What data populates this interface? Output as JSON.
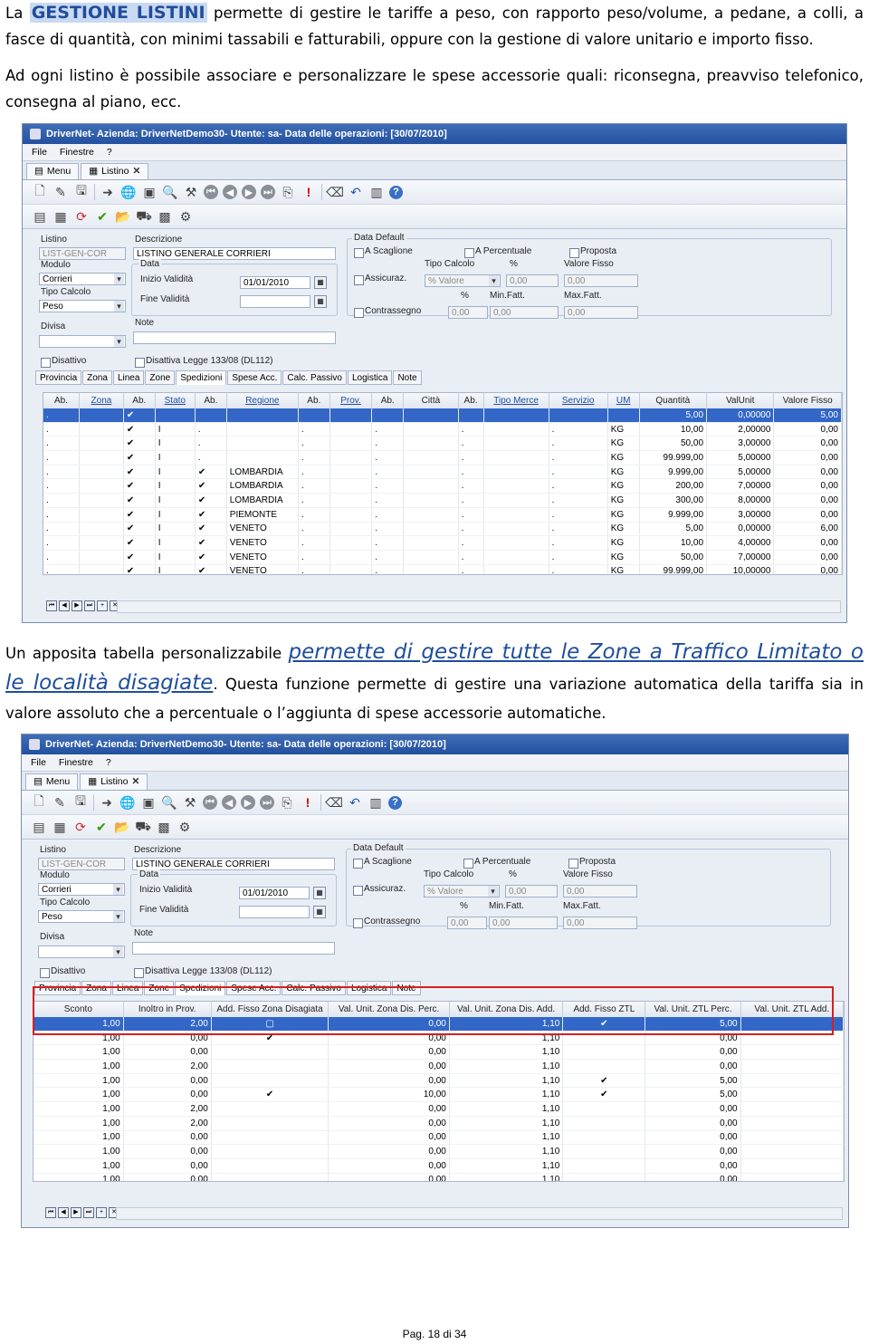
{
  "intro": {
    "la": "La",
    "highlight": "GESTIONE LISTINI",
    "rest": "permette di gestire le tariffe a peso, con rapporto peso/volume, a pedane, a colli, a fasce di quantità, con minimi tassabili e fatturabili, oppure con la gestione di valore unitario e importo fisso.",
    "line2": "Ad ogni listino è possibile associare e personalizzare le spese accessorie quali: riconsegna, preavviso telefonico, consegna al piano, ecc."
  },
  "para2": {
    "before": "Un apposita tabella personalizzabile",
    "link": "permette di gestire tutte le Zone a Traffico Limitato o le località disagiate",
    "after": ". Questa funzione permette di gestire una variazione automatica della tariffa sia in valore assoluto che a percentuale o l’aggiunta di spese accessorie automatiche."
  },
  "footer": "Pag. 18 di 34",
  "window": {
    "title1": "DriverNet- Azienda: DriverNetDemo30- Utente: sa- Data delle operazioni: [30/07/2010]",
    "title2": "DriverNet- Azienda: DriverNetDemo30- Utente: sa- Data delle operazioni: [30/07/2010]",
    "menu": [
      "File",
      "Finestre",
      "?"
    ],
    "tabs": [
      "Menu",
      "Listino"
    ]
  },
  "form": {
    "listino_label": "Listino",
    "listino_value": "LIST-GEN-COR",
    "descr_label": "Descrizione",
    "descr_value": "LISTINO GENERALE CORRIERI",
    "modulo_label": "Modulo",
    "modulo_value": "Corrieri",
    "tipo_label": "Tipo Calcolo",
    "tipo_value": "Peso",
    "divisa_label": "Divisa",
    "note_label": "Note",
    "data_label": "Data",
    "inizio_label": "Inizio Validità",
    "inizio_value": "01/01/2010",
    "fine_label": "Fine Validità",
    "datadef_label": "Data Default",
    "scaglione": "A Scaglione",
    "percentuale": "A Percentuale",
    "proposta": "Proposta",
    "assicuraz": "Assicuraz.",
    "tipocalc2": "Tipo Calcolo",
    "perc": "%",
    "valorefisso": "Valore Fisso",
    "percvalore": "% Valore",
    "zero": "0,00",
    "perc2": "%",
    "minfatt": "Min.Fatt.",
    "maxfatt": "Max.Fatt.",
    "contrassegno": "Contrassegno",
    "disattivo": "Disattivo",
    "legge": "Disattiva Legge 133/08 (DL112)"
  },
  "subtabs": [
    "Provincia",
    "Zona",
    "Linea",
    "Zone",
    "Spedizioni",
    "Spese Acc.",
    "Calc. Passivo",
    "Logistica",
    "Note"
  ],
  "grid1": {
    "headers": [
      "Ab.",
      "Zona",
      "Ab.",
      "Stato",
      "Ab.",
      "Regione",
      "Ab.",
      "Prov.",
      "Ab.",
      "Città",
      "Ab.",
      "Tipo Merce",
      "Servizio",
      "UM",
      "Quantità",
      "ValUnit",
      "Valore Fisso"
    ],
    "rows": [
      [
        ".",
        "",
        "✔",
        "",
        "",
        "",
        "",
        "",
        "",
        "",
        "",
        "",
        "",
        "",
        "5,00",
        "0,00000",
        "5,00"
      ],
      [
        ".",
        "",
        "✔",
        "I",
        ".",
        "",
        ".",
        "",
        ".",
        "",
        ".",
        "",
        ".",
        "KG",
        "10,00",
        "2,00000",
        "0,00"
      ],
      [
        ".",
        "",
        "✔",
        "I",
        ".",
        "",
        ".",
        "",
        ".",
        "",
        ".",
        "",
        ".",
        "KG",
        "50,00",
        "3,00000",
        "0,00"
      ],
      [
        ".",
        "",
        "✔",
        "I",
        ".",
        "",
        ".",
        "",
        ".",
        "",
        ".",
        "",
        ".",
        "KG",
        "99.999,00",
        "5,00000",
        "0,00"
      ],
      [
        ".",
        "",
        "✔",
        "I",
        "✔",
        "LOMBARDIA",
        ".",
        "",
        ".",
        "",
        ".",
        "",
        ".",
        "KG",
        "9.999,00",
        "5,00000",
        "0,00"
      ],
      [
        ".",
        "",
        "✔",
        "I",
        "✔",
        "LOMBARDIA",
        ".",
        "",
        ".",
        "",
        ".",
        "",
        ".",
        "KG",
        "200,00",
        "7,00000",
        "0,00"
      ],
      [
        ".",
        "",
        "✔",
        "I",
        "✔",
        "LOMBARDIA",
        ".",
        "",
        ".",
        "",
        ".",
        "",
        ".",
        "KG",
        "300,00",
        "8,00000",
        "0,00"
      ],
      [
        ".",
        "",
        "✔",
        "I",
        "✔",
        "PIEMONTE",
        ".",
        "",
        ".",
        "",
        ".",
        "",
        ".",
        "KG",
        "9.999,00",
        "3,00000",
        "0,00"
      ],
      [
        ".",
        "",
        "✔",
        "I",
        "✔",
        "VENETO",
        ".",
        "",
        ".",
        "",
        ".",
        "",
        ".",
        "KG",
        "5,00",
        "0,00000",
        "6,00"
      ],
      [
        ".",
        "",
        "✔",
        "I",
        "✔",
        "VENETO",
        ".",
        "",
        ".",
        "",
        ".",
        "",
        ".",
        "KG",
        "10,00",
        "4,00000",
        "0,00"
      ],
      [
        ".",
        "",
        "✔",
        "I",
        "✔",
        "VENETO",
        ".",
        "",
        ".",
        "",
        ".",
        "",
        ".",
        "KG",
        "50,00",
        "7,00000",
        "0,00"
      ],
      [
        ".",
        "",
        "✔",
        "I",
        "✔",
        "VENETO",
        ".",
        "",
        ".",
        "",
        ".",
        "",
        ".",
        "KG",
        "99.999,00",
        "10,00000",
        "0,00"
      ]
    ]
  },
  "grid2": {
    "headers": [
      "Sconto",
      "Inoltro in Prov.",
      "Add. Fisso Zona Disagiata",
      "Val. Unit. Zona Dis. Perc.",
      "Val. Unit. Zona Dis. Add.",
      "Add. Fisso ZTL",
      "Val. Unit. ZTL Perc.",
      "Val. Unit. ZTL Add."
    ],
    "rows": [
      [
        "1,00",
        "2,00",
        "▢",
        "0,00",
        "1,10",
        "✔",
        "5,00"
      ],
      [
        "1,00",
        "0,00",
        "✔",
        "0,00",
        "1,10",
        "",
        "0,00"
      ],
      [
        "1,00",
        "0,00",
        "",
        "0,00",
        "1,10",
        "",
        "0,00"
      ],
      [
        "1,00",
        "2,00",
        "",
        "0,00",
        "1,10",
        "",
        "0,00"
      ],
      [
        "1,00",
        "0,00",
        "",
        "0,00",
        "1,10",
        "✔",
        "5,00"
      ],
      [
        "1,00",
        "0,00",
        "✔",
        "10,00",
        "1,10",
        "✔",
        "5,00"
      ],
      [
        "1,00",
        "2,00",
        "",
        "0,00",
        "1,10",
        "",
        "0,00"
      ],
      [
        "1,00",
        "2,00",
        "",
        "0,00",
        "1,10",
        "",
        "0,00"
      ],
      [
        "1,00",
        "0,00",
        "",
        "0,00",
        "1,10",
        "",
        "0,00"
      ],
      [
        "1,00",
        "0,00",
        "",
        "0,00",
        "1,10",
        "",
        "0,00"
      ],
      [
        "1,00",
        "0,00",
        "",
        "0,00",
        "1,10",
        "",
        "0,00"
      ],
      [
        "1,00",
        "0,00",
        "",
        "0,00",
        "1,10",
        "",
        "0,00"
      ]
    ]
  },
  "colors": {
    "accent": "#1f4e9a",
    "selection": "#3367c7",
    "highlight_box": "#d62020"
  }
}
